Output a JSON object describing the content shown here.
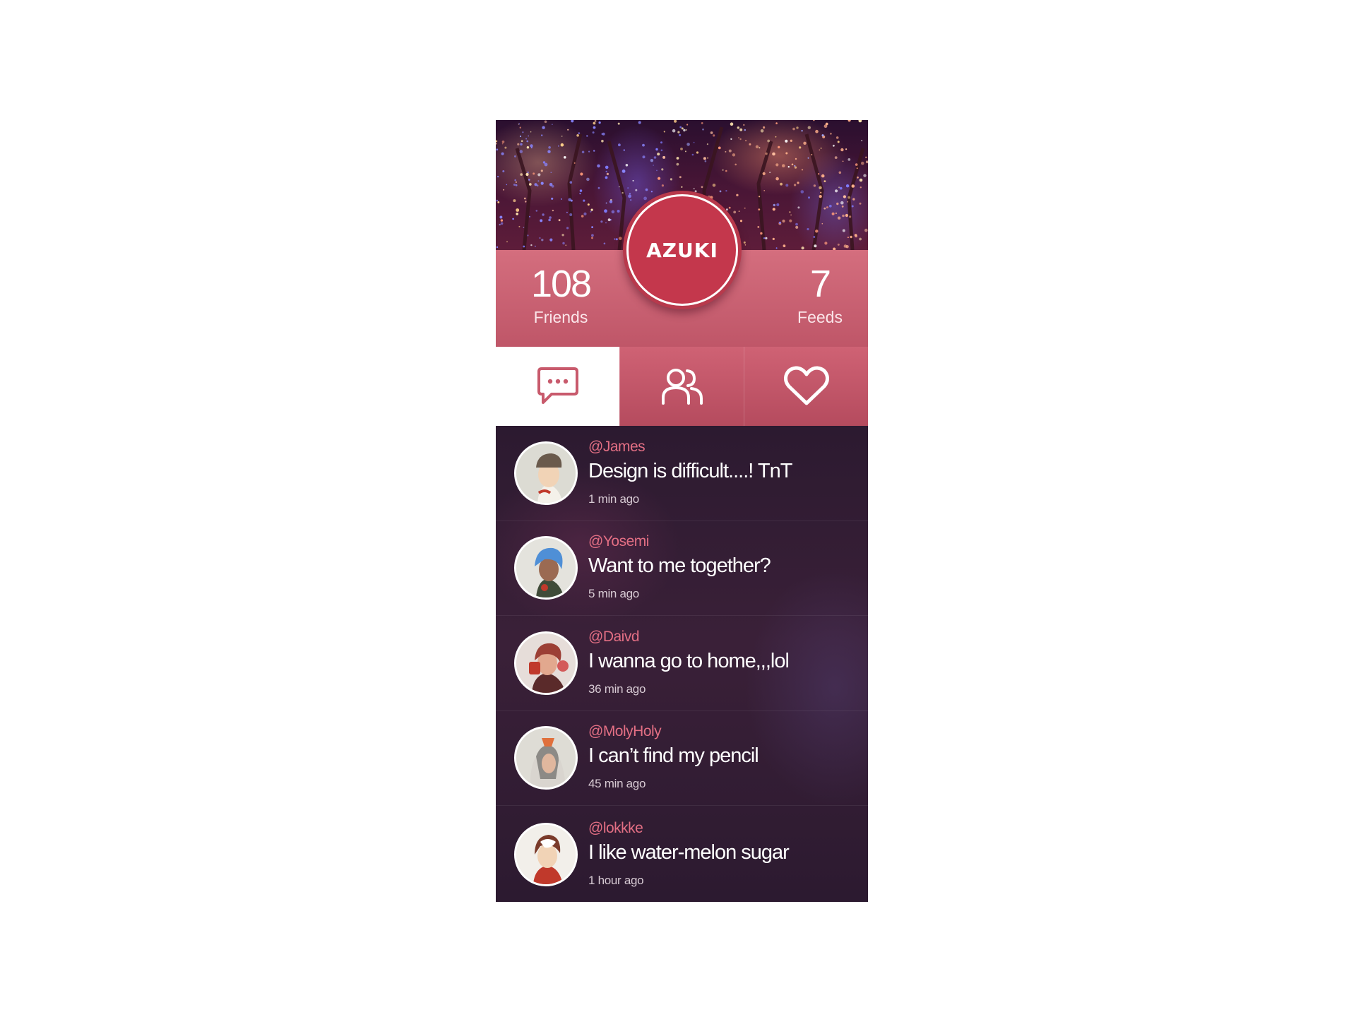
{
  "profile": {
    "logo_text": "AZUKI",
    "friends_count": "108",
    "friends_label": "Friends",
    "feeds_count": "7",
    "feeds_label": "Feeds"
  },
  "tabs": [
    {
      "name": "messages",
      "icon": "chat-bubble-icon",
      "active": true
    },
    {
      "name": "friends",
      "icon": "users-icon",
      "active": false
    },
    {
      "name": "favorites",
      "icon": "heart-icon",
      "active": false
    }
  ],
  "feed": [
    {
      "handle": "@James",
      "message": "Design is difficult....! TnT",
      "time": "1 min ago"
    },
    {
      "handle": "@Yosemi",
      "message": "Want to me together?",
      "time": "5 min ago"
    },
    {
      "handle": "@Daivd",
      "message": "I wanna go to home,,,lol",
      "time": "36 min ago"
    },
    {
      "handle": "@MolyHoly",
      "message": "I can’t find my pencil",
      "time": "45 min ago"
    },
    {
      "handle": "@lokkke",
      "message": "I like water-melon sugar",
      "time": "1 hour ago"
    }
  ],
  "colors": {
    "accent": "#cf6274",
    "logo": "#c4374c",
    "handle": "#e36f84",
    "feed_bg": "#2c1a30"
  }
}
